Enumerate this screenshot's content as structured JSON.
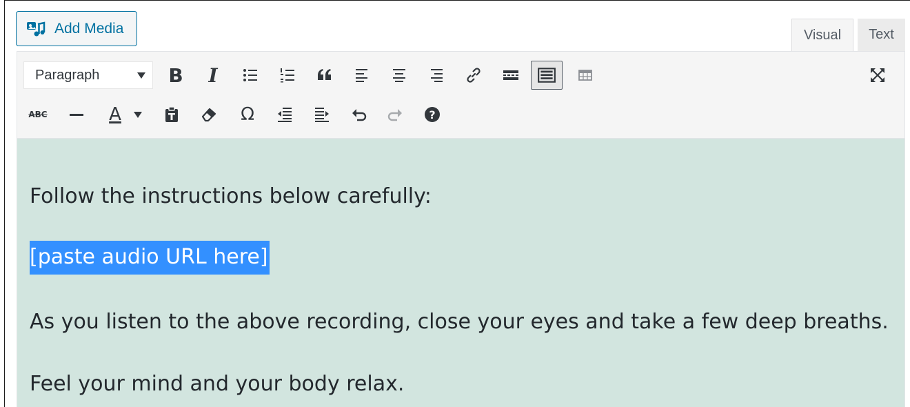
{
  "add_media": {
    "label": "Add Media",
    "icon": "media-icon"
  },
  "tabs": [
    {
      "label": "Visual",
      "active": true
    },
    {
      "label": "Text",
      "active": false
    }
  ],
  "toolbar": {
    "format_select": {
      "value": "Paragraph"
    },
    "row1": [
      "bold",
      "italic",
      "bulleted-list",
      "numbered-list",
      "blockquote",
      "align-left",
      "align-center",
      "align-right",
      "insert-link",
      "read-more",
      "toolbar-toggle",
      "table",
      "fullscreen"
    ],
    "row2": [
      "strikethrough",
      "horizontal-line",
      "text-color",
      "paste-as-text",
      "clear-formatting",
      "special-character",
      "decrease-indent",
      "increase-indent",
      "undo",
      "redo",
      "keyboard-shortcuts"
    ],
    "bold_glyph": "B",
    "italic_glyph": "I",
    "quote_glyph": "66",
    "omega_glyph": "Ω",
    "strike_glyph": "ABC",
    "textcolor_glyph": "A",
    "help_glyph": "?"
  },
  "content": {
    "paragraphs": [
      "Follow the instructions below carefully:",
      "[paste audio URL here]",
      "As you listen to the above recording, close your eyes and take a few deep breaths.",
      "Feel your mind and your body relax."
    ],
    "selected_index": 1
  },
  "colors": {
    "accent": "#0071a1",
    "selection": "#3390ff",
    "editor_bg": "#d2e5df",
    "toolbar_bg": "#f5f5f5"
  }
}
